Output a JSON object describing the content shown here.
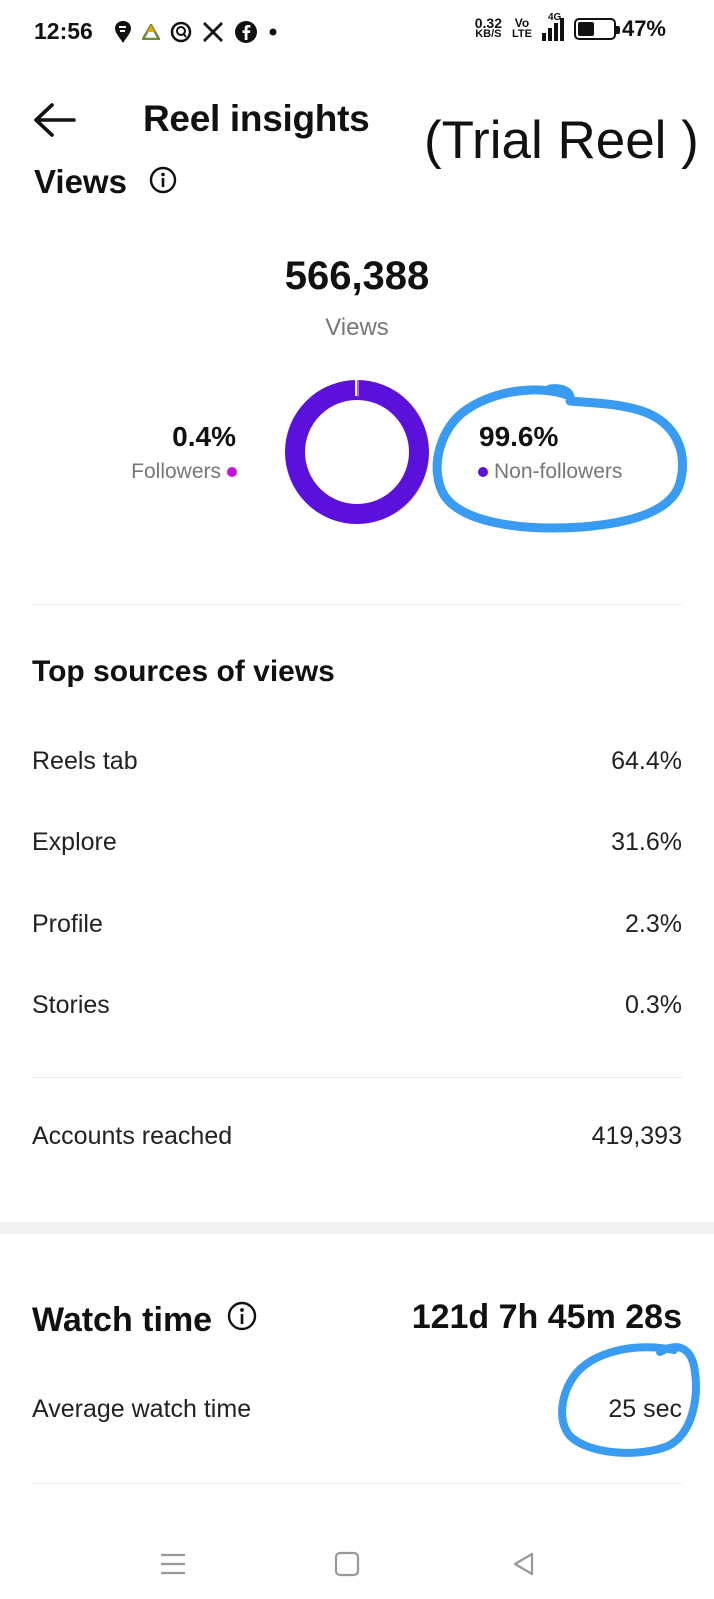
{
  "status_bar": {
    "time": "12:56",
    "net_speed_value": "0.32",
    "net_speed_unit": "KB/S",
    "volte_top": "Vo",
    "volte_bottom": "LTE",
    "network": "4G",
    "battery": "47%",
    "battery_level": 0.47,
    "notification_icons": [
      "swiggy-icon",
      "drive-icon",
      "quora-icon",
      "x-icon",
      "facebook-icon",
      "more-dot-icon"
    ]
  },
  "header": {
    "title": "Reel insights",
    "handwritten_note": "(Trial Reel )"
  },
  "views": {
    "heading": "Views",
    "total": "566,388",
    "total_label": "Views",
    "followers_pct": "0.4%",
    "followers_label": "Followers",
    "followers_share": 0.4,
    "non_followers_pct": "99.6%",
    "non_followers_label": "Non-followers",
    "non_followers_share": 99.6,
    "colors": {
      "followers": "#c514d4",
      "non_followers": "#5b10dc"
    }
  },
  "top_sources": {
    "title": "Top sources of views",
    "rows": [
      {
        "label": "Reels tab",
        "value": "64.4%"
      },
      {
        "label": "Explore",
        "value": "31.6%"
      },
      {
        "label": "Profile",
        "value": "2.3%"
      },
      {
        "label": "Stories",
        "value": "0.3%"
      }
    ]
  },
  "accounts_reached": {
    "label": "Accounts reached",
    "value": "419,393"
  },
  "watch_time": {
    "title": "Watch time",
    "total": "121d 7h 45m 28s",
    "avg_label": "Average watch time",
    "avg_value": "25 sec"
  },
  "annotation_color": "#3a9bf2"
}
